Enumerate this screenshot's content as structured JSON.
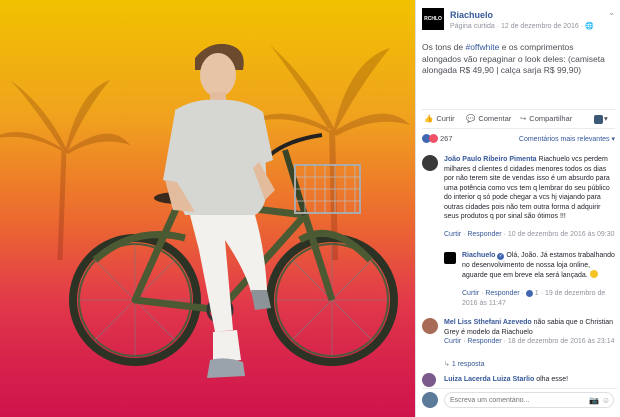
{
  "post": {
    "page_name": "Riachuelo",
    "page_logo_text": "RCHLO",
    "meta": "Página curtida · 12 de dezembro de 2016 · 🌐",
    "text_before": "Os tons de ",
    "hashtag": "#offwhite",
    "text_after": " e os comprimentos alongados vão repaginar o look deles: (camiseta alongada R$ 49,90 | calça sarja R$ 99,90)"
  },
  "actions": {
    "like": "Curtir",
    "comment": "Comentar",
    "share": "Compartilhar"
  },
  "reactions": {
    "count": "267",
    "sort_label": "Comentários mais relevantes ▾"
  },
  "comments": [
    {
      "author": "João Paulo Ribeiro Pimenta",
      "text": "Riachuelo vcs perdem milhares d clientes d cidades menores todos os dias por não terem site de vendas isso é um absurdo para uma potência como vcs tem q lembrar do seu público do interior q só pode chegar a vcs hj viajando para outras cidades pois não tem outra forma d adquirir seus produtos q por sinal são ótimos !!!",
      "like": "Curtir",
      "reply": "Responder",
      "time": "10 de dezembro de 2016 às 09:30"
    },
    {
      "author": "Riachuelo",
      "text": "Olá, João. Já estamos trabalhando no desenvolvimento de nossa loja online, aguarde que em breve ela será lançada.",
      "like": "Curtir",
      "reply": "Responder",
      "likes": "1",
      "time": "19 de dezembro de 2016 às 11:47"
    },
    {
      "author": "Mel Liss Sthefani Azevedo",
      "text": "não sabia que o Christian Grey é modelo da Riachuelo",
      "like": "Curtir",
      "reply": "Responder",
      "time": "18 de dezembro de 2016 às 23:14",
      "replies": "1 resposta"
    },
    {
      "author": "Luiza Lacerda",
      "tagged": "Luiza Starlio",
      "text": "olha esse!"
    }
  ],
  "write_placeholder": "Escreva um comentário...",
  "colors": {
    "link": "#365899",
    "like_blue": "#4267b2",
    "love_red": "#f25268"
  }
}
